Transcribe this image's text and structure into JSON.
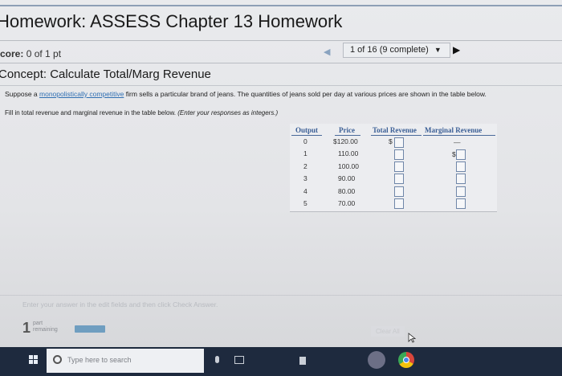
{
  "header": {
    "title": "Homework: ASSESS Chapter 13 Homework"
  },
  "score": {
    "label": "core:",
    "value": "0 of 1 pt"
  },
  "question_nav": {
    "label": "1 of 16 (9 complete)",
    "dropdown_icon": "caret-down-icon",
    "next_icon": "play-arrow-icon"
  },
  "concept": {
    "text": "Concept: Calculate Total/Marg Revenue"
  },
  "question": {
    "intro_before": "Suppose a ",
    "intro_link": "monopolistically competitive",
    "intro_after": " firm sells a particular brand of jeans. The quantities of jeans sold per day at various prices are shown in the table below.",
    "instruction": "Fill in total revenue and marginal revenue in the table below.",
    "instruction_hint": "(Enter your responses as integers.)"
  },
  "table": {
    "headers": {
      "output": "Output",
      "price": "Price",
      "total_revenue": "Total Revenue",
      "marginal_revenue": "Marginal Revenue"
    },
    "rows": [
      {
        "output": "0",
        "price": "$120.00",
        "tr_prefix": "$",
        "mr": "—"
      },
      {
        "output": "1",
        "price": "110.00",
        "tr_prefix": "",
        "mr_prefix": "$"
      },
      {
        "output": "2",
        "price": "100.00",
        "tr_prefix": "",
        "mr_prefix": ""
      },
      {
        "output": "3",
        "price": "90.00",
        "tr_prefix": "",
        "mr_prefix": ""
      },
      {
        "output": "4",
        "price": "80.00",
        "tr_prefix": "",
        "mr_prefix": ""
      },
      {
        "output": "5",
        "price": "70.00",
        "tr_prefix": "",
        "mr_prefix": ""
      }
    ]
  },
  "footer": {
    "instruction": "Enter your answer in the edit fields and then click Check Answer.",
    "parts_count": "1",
    "parts_label_1": "part",
    "parts_label_2": "remaining",
    "progress_fraction": 0.0,
    "clear_all": "Clear All"
  },
  "taskbar": {
    "search_placeholder": "Type here to search"
  },
  "colors": {
    "header_blue": "#3a5e95",
    "link": "#2f6fb2",
    "taskbar": "#1e2a3e",
    "progress": "#6f9ec0"
  }
}
